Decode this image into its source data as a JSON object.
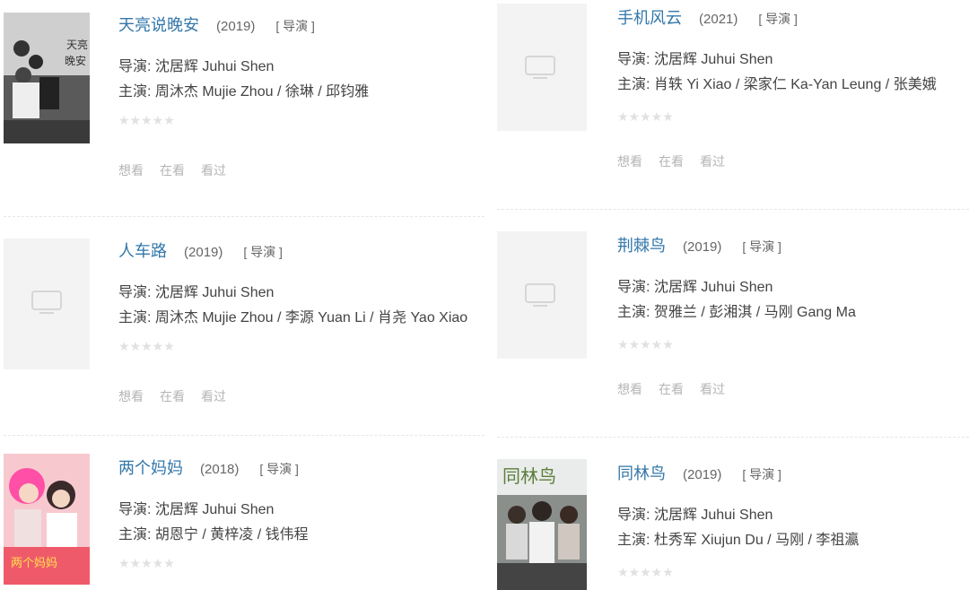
{
  "labels": {
    "director_prefix": "导演: ",
    "cast_prefix": "主演: ",
    "role_tag": "[ 导演 ]",
    "stars": "★★★★★",
    "action_want": "想看",
    "action_watching": "在看",
    "action_watched": "看过"
  },
  "films": [
    {
      "title": "天亮说晚安",
      "year": "(2019)",
      "director": "沈居辉 Juhui Shen",
      "cast": "周沐杰 Mujie Zhou / 徐琳 / 邱钧雅",
      "poster": "天亮说晚安-poster"
    },
    {
      "title": "手机风云",
      "year": "(2021)",
      "director": "沈居辉 Juhui Shen",
      "cast": "肖轶 Yi Xiao / 梁家仁 Ka-Yan Leung / 张美娥",
      "poster": "placeholder"
    },
    {
      "title": "人车路",
      "year": "(2019)",
      "director": "沈居辉 Juhui Shen",
      "cast": "周沐杰 Mujie Zhou / 李源 Yuan Li / 肖尧 Yao Xiao",
      "poster": "placeholder"
    },
    {
      "title": "荆棘鸟",
      "year": "(2019)",
      "director": "沈居辉 Juhui Shen",
      "cast": "贺雅兰 / 彭湘淇 / 马刚 Gang Ma",
      "poster": "placeholder"
    },
    {
      "title": "两个妈妈",
      "year": "(2018)",
      "director": "沈居辉 Juhui Shen",
      "cast": "胡恩宁 / 黄梓凌 / 钱伟程",
      "poster": "两个妈妈-poster"
    },
    {
      "title": "同林鸟",
      "year": "(2019)",
      "director": "沈居辉 Juhui Shen",
      "cast": "杜秀军 Xiujun Du / 马刚 / 李祖瀛",
      "poster": "同林鸟-poster"
    }
  ]
}
